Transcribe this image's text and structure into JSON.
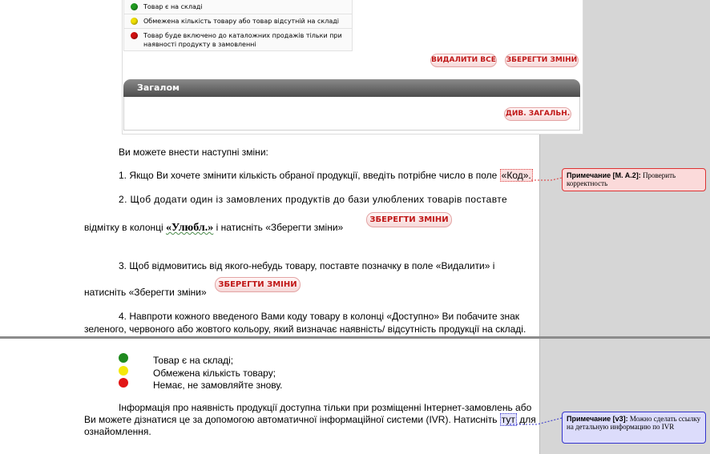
{
  "embedded_screenshot": {
    "legend": [
      {
        "color": "#1f9a1f",
        "text": "Товар є на складі"
      },
      {
        "color": "#f0e000",
        "text": "Обмежена кількість товару або товар відсутній на складі"
      },
      {
        "color": "#d01010",
        "text": "Товар буде включено до каталожних продажів тільки при наявності продукту в замовленні"
      }
    ],
    "delete_all_label": "ВИДАЛИТИ ВСЕ",
    "save_changes_label": "ЗБЕРЕГТИ ЗМІНИ",
    "panel_title": "Загалом",
    "view_total_label": "ДИВ. ЗАГАЛЬН."
  },
  "document": {
    "intro": "Ви можете внести наступні зміни:",
    "item1_prefix": "1. Якщо Ви хочете змінити кількість обраної продукції, введіть потрібне число в поле ",
    "item1_marked": "«Код».",
    "item2_line1": "2. Щоб додати один із замовлених продуктів до бази улюблених товарів поставте",
    "item2_line2_prefix": "відмітку в колонці ",
    "item2_bold": "«Улюбл.»",
    "item2_line2_suffix": " і натисніть «Зберегти зміни»",
    "item2_button": "ЗБЕРЕГТИ ЗМІНИ",
    "item3_line1": "3. Щоб відмовитись від якого-небудь товару, поставте позначку в поле «Видалити» і",
    "item3_line2": "натисніть «Зберегти зміни»",
    "item3_button": "ЗБЕРЕГТИ ЗМІНИ",
    "item4_line1": "4. Навпроти кожного введеного Вами коду товару в колонці «Доступно» Ви побачите знак",
    "item4_line2": "зеленого, червоного або жовтого кольору, який визначає наявність/ відсутність продукції на складі.",
    "bullets": [
      {
        "color": "#1f8a1f",
        "text": "Товар є на складі;"
      },
      {
        "color": "#f4e80a",
        "text": "Обмежена кількість товару;"
      },
      {
        "color": "#e21616",
        "text": "Немає, не замовляйте знову."
      }
    ],
    "info_line1": "Інформація про наявність продукції доступна тільки при розміщенні Інтернет-замовлень або",
    "info_line2_prefix": "Ви можете дізнатися це за допомогою автоматичної інформаційної системи (IVR). Натисніть ",
    "info_marked": "тут",
    "info_line2_suffix": " для",
    "info_line3": "ознайомлення."
  },
  "comments": [
    {
      "author": "Примечание [M. A.2]:",
      "text": "Проверить корректность",
      "color": "#d33333"
    },
    {
      "author": "Примечание [v3]:",
      "text": "Можно сделать ссылку на детальную информацию по IVR",
      "color": "#3333cc"
    }
  ]
}
